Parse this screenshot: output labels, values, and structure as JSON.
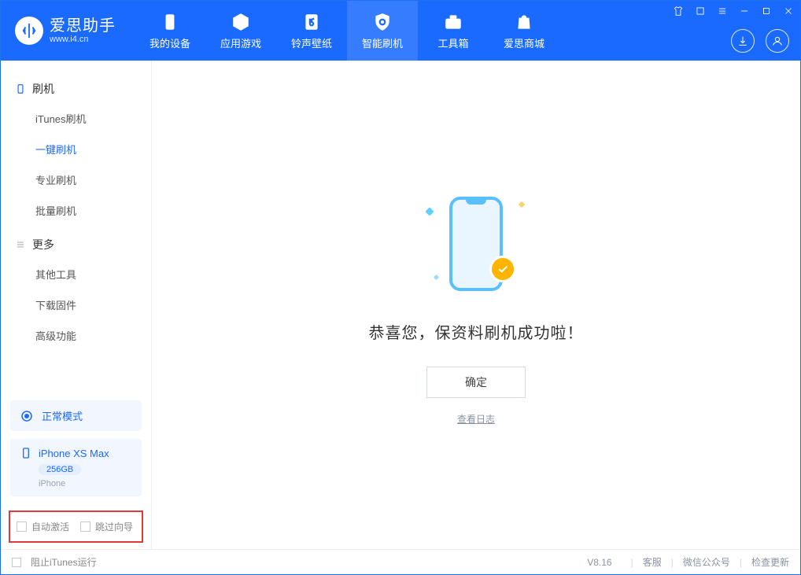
{
  "app": {
    "title": "爱思助手",
    "subtitle": "www.i4.cn"
  },
  "nav": {
    "my_device": "我的设备",
    "apps_games": "应用游戏",
    "ring_wall": "铃声壁纸",
    "smart_flash": "智能刷机",
    "toolbox": "工具箱",
    "store": "爱思商城"
  },
  "sidebar": {
    "group_flash": "刷机",
    "itunes_flash": "iTunes刷机",
    "one_click_flash": "一键刷机",
    "pro_flash": "专业刷机",
    "batch_flash": "批量刷机",
    "group_more": "更多",
    "other_tools": "其他工具",
    "download_firmware": "下载固件",
    "advanced_features": "高级功能"
  },
  "device_mode": "正常模式",
  "device": {
    "name": "iPhone XS Max",
    "storage": "256GB",
    "type": "iPhone"
  },
  "options": {
    "auto_activate": "自动激活",
    "skip_guide": "跳过向导"
  },
  "main": {
    "success_title": "恭喜您，保资料刷机成功啦！",
    "confirm": "确定",
    "view_log": "查看日志"
  },
  "footer": {
    "block_itunes": "阻止iTunes运行",
    "version": "V8.16",
    "service": "客服",
    "wechat": "微信公众号",
    "check_update": "检查更新"
  }
}
